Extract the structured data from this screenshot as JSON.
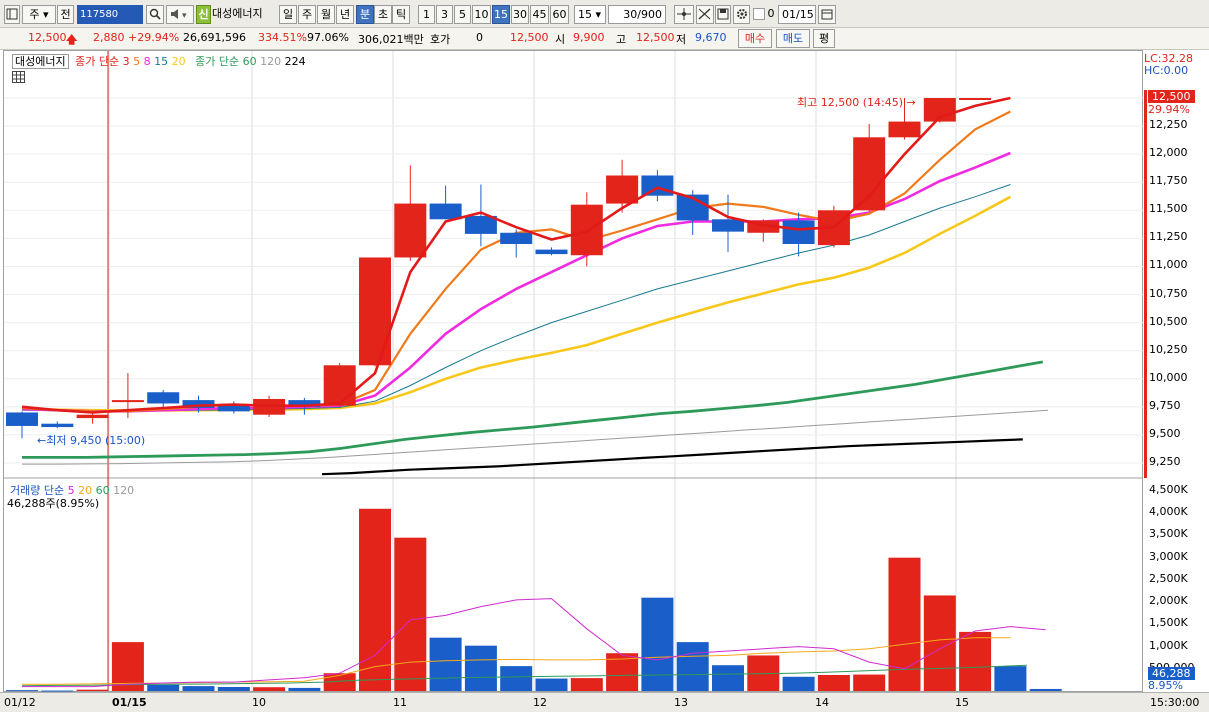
{
  "toolbar": {
    "market_label": "주",
    "prev_label": "전",
    "code_value": "117580",
    "new_badge": "신",
    "stock_name": "대성에너지",
    "periods": [
      "일",
      "주",
      "월",
      "년",
      "분",
      "초",
      "틱"
    ],
    "active_period": "분",
    "intervals": [
      "1",
      "3",
      "5",
      "10",
      "15",
      "30",
      "45",
      "60"
    ],
    "active_interval": "15",
    "interval_select": "15",
    "count_value": "30",
    "count_total": "/900",
    "date_value": "01/15",
    "checkbox_label": "0",
    "icons": [
      "menu-icon",
      "search-icon",
      "speaker-icon",
      "crosshair-icon",
      "draw-icon",
      "save-icon",
      "gear-icon"
    ]
  },
  "quote": {
    "price": "12,500",
    "change": "2,880",
    "change_pct": "+29.94%",
    "volume": "26,691,596",
    "volume_ratio": "334.51%",
    "strength": "97.06%",
    "amount": "306,021백만",
    "bid_label": "호가",
    "bid_value": "0",
    "bid_price": "12,500",
    "open_label": "시",
    "open": "9,900",
    "high_label": "고",
    "high": "12,500",
    "low_label": "저",
    "low": "9,670",
    "buy_label": "매수",
    "sell_label": "매도",
    "flat_label": "평"
  },
  "legend_price": {
    "name": "대성에너지",
    "ma1_label": "종가 단순",
    "ma1_periods": [
      "3",
      "5",
      "8",
      "15",
      "20"
    ],
    "ma2_label": "종가 단순",
    "ma2_periods": [
      "60",
      "120",
      "224"
    ]
  },
  "legend_volume": {
    "label": "거래량 단순",
    "periods": [
      "5",
      "20",
      "60",
      "120"
    ],
    "current": "46,288주(8.95%)"
  },
  "annotations": {
    "high": "최고 12,500 (14:45)",
    "low": "최저 9,450 (15:00)",
    "lc": "LC:32.28",
    "hc": "HC:0.00",
    "price_tag": "12,500",
    "pct_tag": "29.94%",
    "vol_tag": "46,288",
    "vol_pct_tag": "8.95%"
  },
  "colors": {
    "up": "#e2241a",
    "down": "#1a5fc9",
    "ma3": "#e31a1a",
    "ma5": "#f07a1a",
    "ma8": "#f02ae0",
    "ma15": "#1a7a90",
    "ma20": "#f7c81a",
    "ma60": "#2e9a5a",
    "ma120": "#9a9a9a",
    "ma224": "#000000"
  },
  "chart_data": {
    "type": "candlestick",
    "x_labels": [
      "01/12",
      "01/15",
      "10",
      "11",
      "12",
      "13",
      "14",
      "15"
    ],
    "y_ticks": [
      "12,500",
      "12,250",
      "12,000",
      "11,750",
      "11,500",
      "11,250",
      "11,000",
      "10,750",
      "10,500",
      "10,250",
      "10,000",
      "9,750",
      "9,500",
      "9,250"
    ],
    "vol_ticks": [
      "4,500K",
      "4,000K",
      "3,500K",
      "3,000K",
      "2,500K",
      "2,000K",
      "1,500K",
      "1,000K",
      "500,000"
    ],
    "time_label": "15:30:00",
    "candles": [
      {
        "o": 9700,
        "h": 9710,
        "l": 9470,
        "c": 9580
      },
      {
        "o": 9600,
        "h": 9620,
        "l": 9560,
        "c": 9570
      },
      {
        "o": 9650,
        "h": 9700,
        "l": 9600,
        "c": 9680
      },
      {
        "o": 9800,
        "h": 10050,
        "l": 9650,
        "c": 9810
      },
      {
        "o": 9880,
        "h": 9900,
        "l": 9730,
        "c": 9780
      },
      {
        "o": 9810,
        "h": 9850,
        "l": 9700,
        "c": 9740
      },
      {
        "o": 9760,
        "h": 9800,
        "l": 9690,
        "c": 9710
      },
      {
        "o": 9680,
        "h": 9850,
        "l": 9660,
        "c": 9820
      },
      {
        "o": 9810,
        "h": 9830,
        "l": 9680,
        "c": 9750
      },
      {
        "o": 9760,
        "h": 10140,
        "l": 9750,
        "c": 10120
      },
      {
        "o": 10120,
        "h": 10980,
        "l": 10110,
        "c": 11080
      },
      {
        "o": 11080,
        "h": 11900,
        "l": 11050,
        "c": 11560
      },
      {
        "o": 11560,
        "h": 11720,
        "l": 11420,
        "c": 11420
      },
      {
        "o": 11450,
        "h": 11730,
        "l": 11180,
        "c": 11290
      },
      {
        "o": 11300,
        "h": 11330,
        "l": 11080,
        "c": 11200
      },
      {
        "o": 11150,
        "h": 11170,
        "l": 11100,
        "c": 11110
      },
      {
        "o": 11100,
        "h": 11660,
        "l": 11000,
        "c": 11550
      },
      {
        "o": 11560,
        "h": 11950,
        "l": 11480,
        "c": 11810
      },
      {
        "o": 11810,
        "h": 11860,
        "l": 11580,
        "c": 11630
      },
      {
        "o": 11640,
        "h": 11680,
        "l": 11280,
        "c": 11410
      },
      {
        "o": 11420,
        "h": 11640,
        "l": 11130,
        "c": 11310
      },
      {
        "o": 11300,
        "h": 11420,
        "l": 11220,
        "c": 11410
      },
      {
        "o": 11410,
        "h": 11480,
        "l": 11090,
        "c": 11200
      },
      {
        "o": 11190,
        "h": 11540,
        "l": 11170,
        "c": 11500
      },
      {
        "o": 11500,
        "h": 12270,
        "l": 11490,
        "c": 12150
      },
      {
        "o": 12150,
        "h": 12500,
        "l": 12130,
        "c": 12290
      },
      {
        "o": 12290,
        "h": 12500,
        "l": 12280,
        "c": 12500
      },
      {
        "o": 12500,
        "h": 12500,
        "l": 12490,
        "c": 12500
      }
    ],
    "volume": [
      20,
      10,
      30,
      1100,
      140,
      110,
      90,
      85,
      70,
      400,
      4100,
      3450,
      1200,
      1020,
      560,
      280,
      290,
      850,
      2100,
      1100,
      580,
      800,
      320,
      360,
      370,
      3000,
      2150,
      1330,
      560,
      46
    ],
    "ma3": [
      9750,
      9720,
      9700,
      9720,
      9740,
      9760,
      9770,
      9760,
      9760,
      9780,
      10050,
      10950,
      11400,
      11480,
      11350,
      11240,
      11310,
      11520,
      11700,
      11610,
      11440,
      11370,
      11330,
      11350,
      11630,
      12000,
      12330,
      12430,
      12500
    ],
    "ma5": [
      9740,
      9720,
      9710,
      9710,
      9730,
      9750,
      9770,
      9760,
      9760,
      9770,
      9900,
      10400,
      10800,
      11150,
      11300,
      11330,
      11230,
      11320,
      11420,
      11520,
      11560,
      11530,
      11460,
      11400,
      11470,
      11650,
      11950,
      12220,
      12380
    ],
    "ma8": [
      9730,
      9720,
      9710,
      9710,
      9720,
      9730,
      9740,
      9740,
      9750,
      9760,
      9850,
      10100,
      10400,
      10620,
      10800,
      10950,
      11100,
      11250,
      11360,
      11400,
      11400,
      11400,
      11420,
      11430,
      11480,
      11600,
      11760,
      11880,
      12010
    ],
    "ma15": [
      9720,
      9715,
      9712,
      9712,
      9715,
      9720,
      9725,
      9730,
      9735,
      9745,
      9800,
      9940,
      10100,
      10250,
      10380,
      10500,
      10600,
      10700,
      10800,
      10880,
      10960,
      11040,
      11120,
      11190,
      11280,
      11400,
      11520,
      11620,
      11730
    ],
    "ma20": [
      9730,
      9725,
      9720,
      9718,
      9718,
      9720,
      9722,
      9724,
      9730,
      9740,
      9780,
      9880,
      10000,
      10100,
      10170,
      10230,
      10300,
      10400,
      10500,
      10590,
      10680,
      10760,
      10840,
      10900,
      10990,
      11120,
      11290,
      11450,
      11620
    ],
    "ma60": [
      9300,
      9300,
      9300,
      9305,
      9310,
      9315,
      9320,
      9325,
      9335,
      9350,
      9380,
      9420,
      9460,
      9490,
      9520,
      9545,
      9570,
      9600,
      9630,
      9660,
      9690,
      9710,
      9735,
      9760,
      9790,
      9830,
      9870,
      9910,
      9950,
      10000,
      10050,
      10100,
      10150
    ],
    "ma120": [
      9240,
      9240,
      9242,
      9245,
      9250,
      9255,
      9260,
      9270,
      9285,
      9300,
      9320,
      9340,
      9360,
      9380,
      9400,
      9420,
      9440,
      9460,
      9480,
      9500,
      9520,
      9540,
      9560,
      9580,
      9600,
      9620,
      9640,
      9660,
      9680,
      9700,
      9720
    ],
    "ma224": [
      9150,
      9160,
      9175,
      9190,
      9200,
      9210,
      9220,
      9235,
      9250,
      9265,
      9280,
      9295,
      9310,
      9325,
      9340,
      9355,
      9370,
      9385,
      9400,
      9410,
      9420,
      9430,
      9440,
      9450,
      9460
    ],
    "vol_ma5": [
      100,
      100,
      100,
      150,
      180,
      200,
      200,
      250,
      300,
      400,
      800,
      1600,
      1700,
      1900,
      2050,
      2080,
      1400,
      800,
      700,
      850,
      900,
      950,
      1000,
      950,
      650,
      500,
      950,
      1350,
      1450,
      1380
    ],
    "vol_ma20": [
      150,
      150,
      160,
      170,
      180,
      190,
      200,
      210,
      220,
      350,
      550,
      650,
      680,
      700,
      710,
      700,
      700,
      720,
      760,
      780,
      800,
      850,
      880,
      900,
      950,
      1050,
      1150,
      1200,
      1200
    ],
    "vol_ma60": [
      120,
      125,
      130,
      140,
      150,
      155,
      160,
      170,
      180,
      200,
      240,
      260,
      280,
      300,
      310,
      320,
      330,
      340,
      350,
      360,
      370,
      380,
      390,
      400,
      420,
      450,
      480,
      500,
      520,
      550,
      580
    ]
  }
}
